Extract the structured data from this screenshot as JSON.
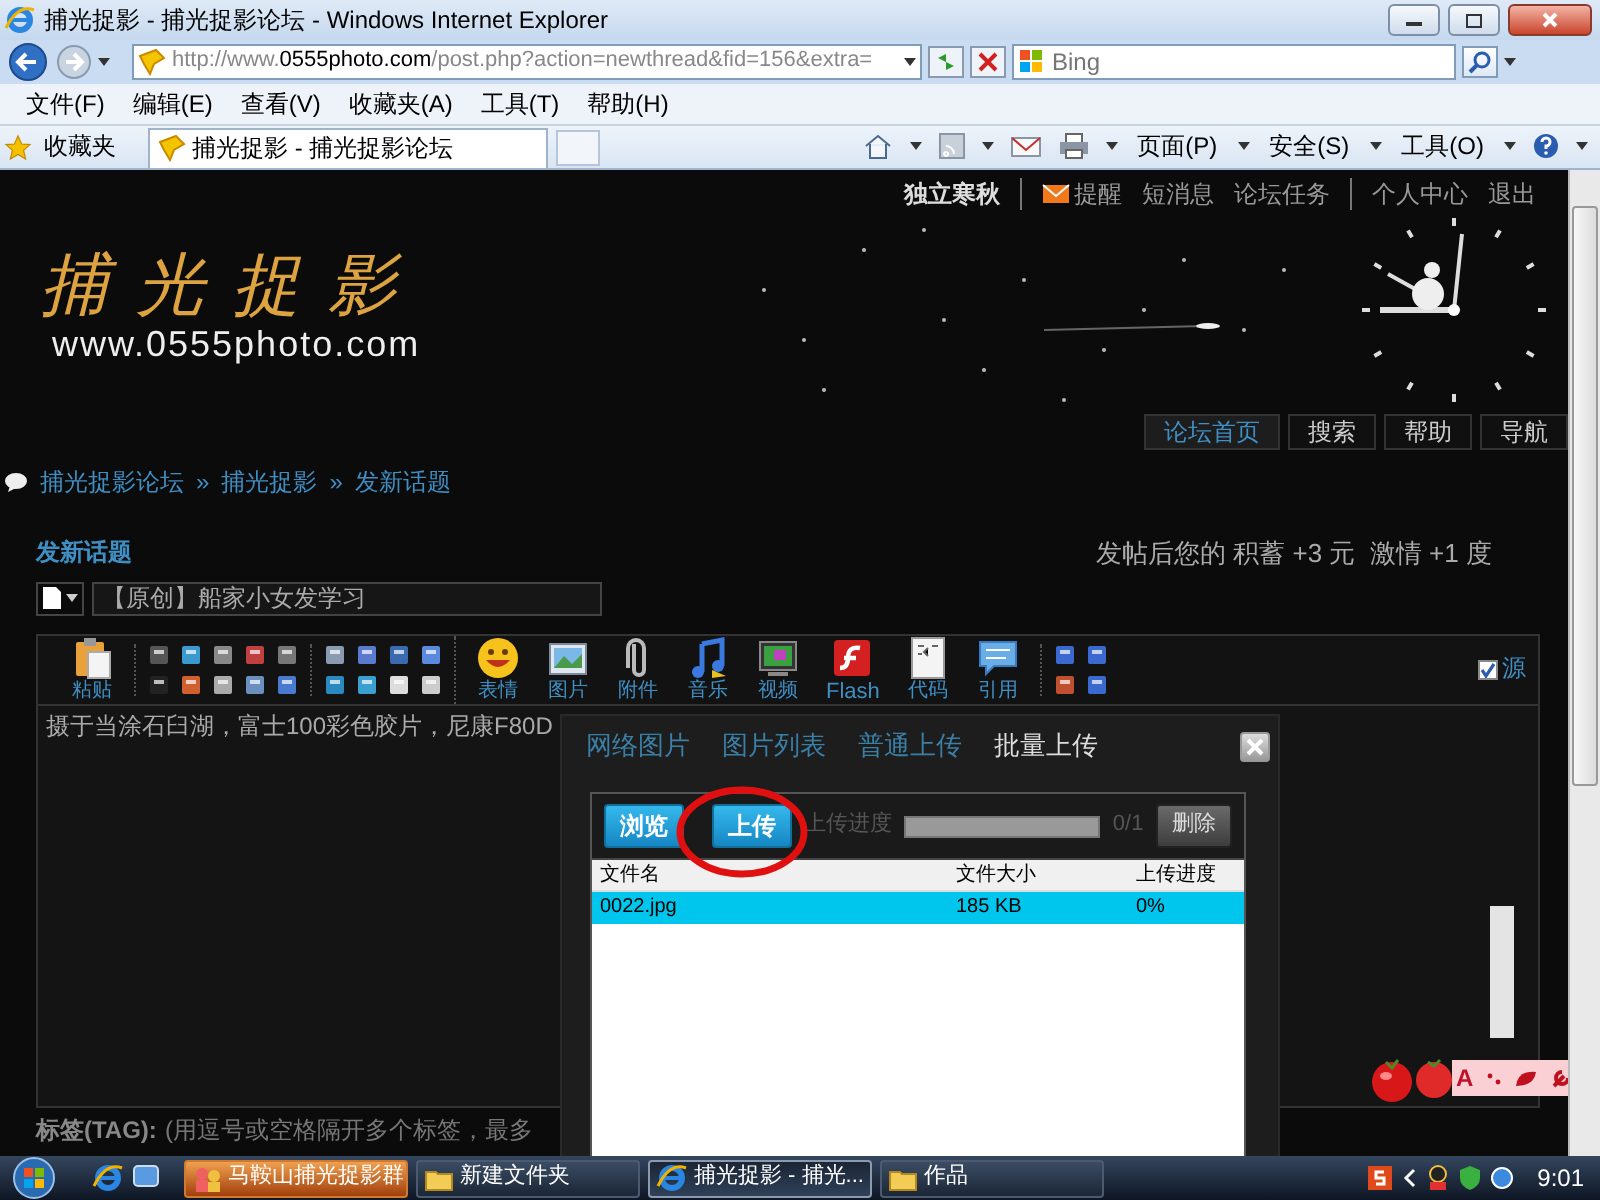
{
  "window": {
    "title": "捕光捉影 - 捕光捉影论坛 - Windows Internet Explorer"
  },
  "address_bar": {
    "url": "http://www.**0555photo.com**/post.php?action=newthread&fid=156&extra="
  },
  "search": {
    "placeholder": "Bing"
  },
  "menu": [
    "文件(F)",
    "编辑(E)",
    "查看(V)",
    "收藏夹(A)",
    "工具(T)",
    "帮助(H)"
  ],
  "favorites_bar": {
    "favorites": "收藏夹",
    "tab": "捕光捉影 - 捕光捉影论坛",
    "tools": [
      "页面(P)",
      "安全(S)",
      "工具(O)"
    ]
  },
  "page": {
    "user_links": [
      [
        {
          "text": "独立寒秋",
          "kind": "user"
        }
      ],
      [
        {
          "text": "提醒",
          "kind": "notice"
        },
        {
          "text": "短消息",
          "kind": "link"
        },
        {
          "text": "论坛任务",
          "kind": "link"
        }
      ],
      [
        {
          "text": "个人中心",
          "kind": "link"
        },
        {
          "text": "退出",
          "kind": "link"
        }
      ]
    ],
    "logo": {
      "title": "捕光捉影",
      "url": "www.0555photo.com"
    },
    "nav": [
      {
        "label": "论坛首页",
        "selected": true
      },
      {
        "label": "搜索",
        "selected": false
      },
      {
        "label": "帮助",
        "selected": false
      },
      {
        "label": "导航",
        "selected": false
      }
    ],
    "breadcrumb": {
      "items": [
        "捕光捉影论坛",
        "捕光捉影",
        "发新话题"
      ],
      "separator": "»"
    },
    "heading": "发新话题",
    "reward": "发帖后您的 积蓄 +3 元  激情 +1 度",
    "subject": "【原创】船家小女发学习",
    "tools": [
      {
        "kind": "paste",
        "label": "粘贴"
      },
      {
        "kind": "smiley",
        "label": "表情"
      },
      {
        "kind": "picture",
        "label": "图片"
      },
      {
        "kind": "clip",
        "label": "附件"
      },
      {
        "kind": "music",
        "label": "音乐"
      },
      {
        "kind": "video",
        "label": "视频"
      },
      {
        "kind": "flash",
        "label": "Flash"
      },
      {
        "kind": "code",
        "label": "代码"
      },
      {
        "kind": "quote",
        "label": "引用"
      }
    ],
    "source_mode": {
      "label": "源",
      "checked": true
    },
    "body": "摄于当涂石臼湖，富士100彩色胶片，尼康F80D",
    "tags_label": "标签(TAG):",
    "tags_hint": "(用逗号或空格隔开多个标签，最多",
    "float_toolbar": {
      "label": "A"
    }
  },
  "dialog": {
    "tabs": [
      {
        "label": "网络图片",
        "selected": false
      },
      {
        "label": "图片列表",
        "selected": false
      },
      {
        "label": "普通上传",
        "selected": false
      },
      {
        "label": "批量上传",
        "selected": true
      }
    ],
    "browse": "浏览",
    "upload": "上传",
    "progress_label": "上传进度",
    "progress": {
      "level": 0
    },
    "count": "0/1",
    "delete": "删除",
    "columns": [
      "文件名",
      "文件大小",
      "上传进度"
    ],
    "rows": [
      {
        "cells": [
          "0022.jpg",
          "185 KB",
          "0%"
        ],
        "selected": true
      }
    ]
  },
  "taskbar": {
    "items": [
      {
        "label": "马鞍山捕光捉影群",
        "kind": "chat",
        "flashing": true,
        "selected": false
      },
      {
        "label": "新建文件夹",
        "kind": "folder",
        "flashing": false,
        "selected": false
      },
      {
        "label": "捕光捉影 - 捕光...",
        "kind": "browser",
        "flashing": false,
        "selected": true
      },
      {
        "label": "作品",
        "kind": "folder",
        "flashing": false,
        "selected": false
      }
    ],
    "clock": "9:01"
  }
}
